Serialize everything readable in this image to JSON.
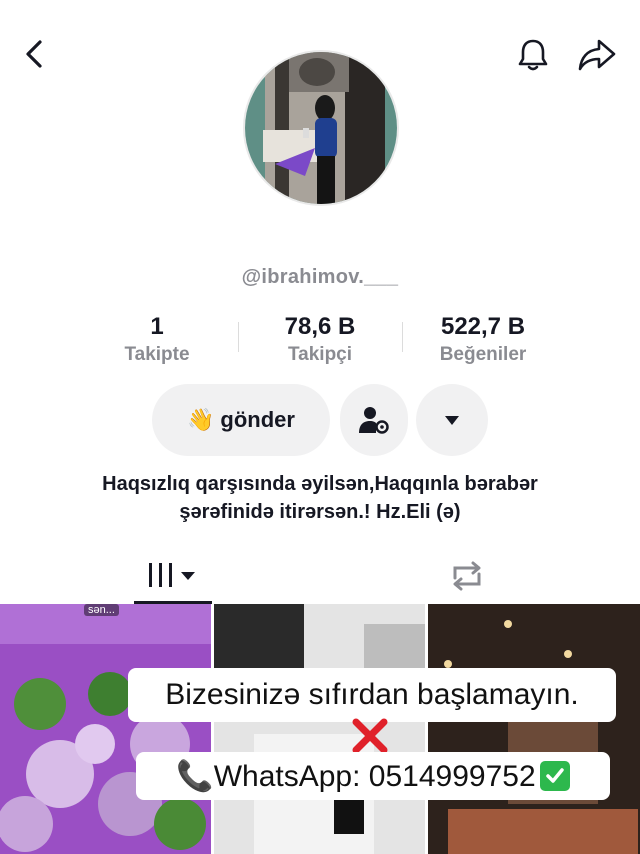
{
  "profile": {
    "username": "@ibrahimov.___",
    "bio_line1": "Haqsızlıq qarşısında əyilsən,Haqqınla bərabər",
    "bio_line2": "şərəfinidə itirərsən.! Hz.Eli (ə)"
  },
  "stats": [
    {
      "value": "1",
      "label": "Takipte"
    },
    {
      "value": "78,6 B",
      "label": "Takipçi"
    },
    {
      "value": "522,7 B",
      "label": "Beğeniler"
    }
  ],
  "actions": {
    "send_label": "gönder",
    "send_emoji": "👋"
  },
  "grid": {
    "cell1_label": "sən..."
  },
  "overlay": {
    "line1": "Bizesinizə sıfırdan başlamayın.",
    "line2_prefix": "📞WhatsApp: 0514999752"
  },
  "icons": {
    "back": "back-chevron-icon",
    "bell": "bell-icon",
    "share": "share-icon",
    "friend": "person-settings-icon",
    "more": "caret-down-icon",
    "videos": "videos-grid-icon",
    "reposts": "repost-icon"
  },
  "colors": {
    "text": "#161823",
    "muted": "#8a8b91",
    "button_bg": "#f1f1f2",
    "cross": "#e0212a",
    "check": "#2db84d"
  }
}
